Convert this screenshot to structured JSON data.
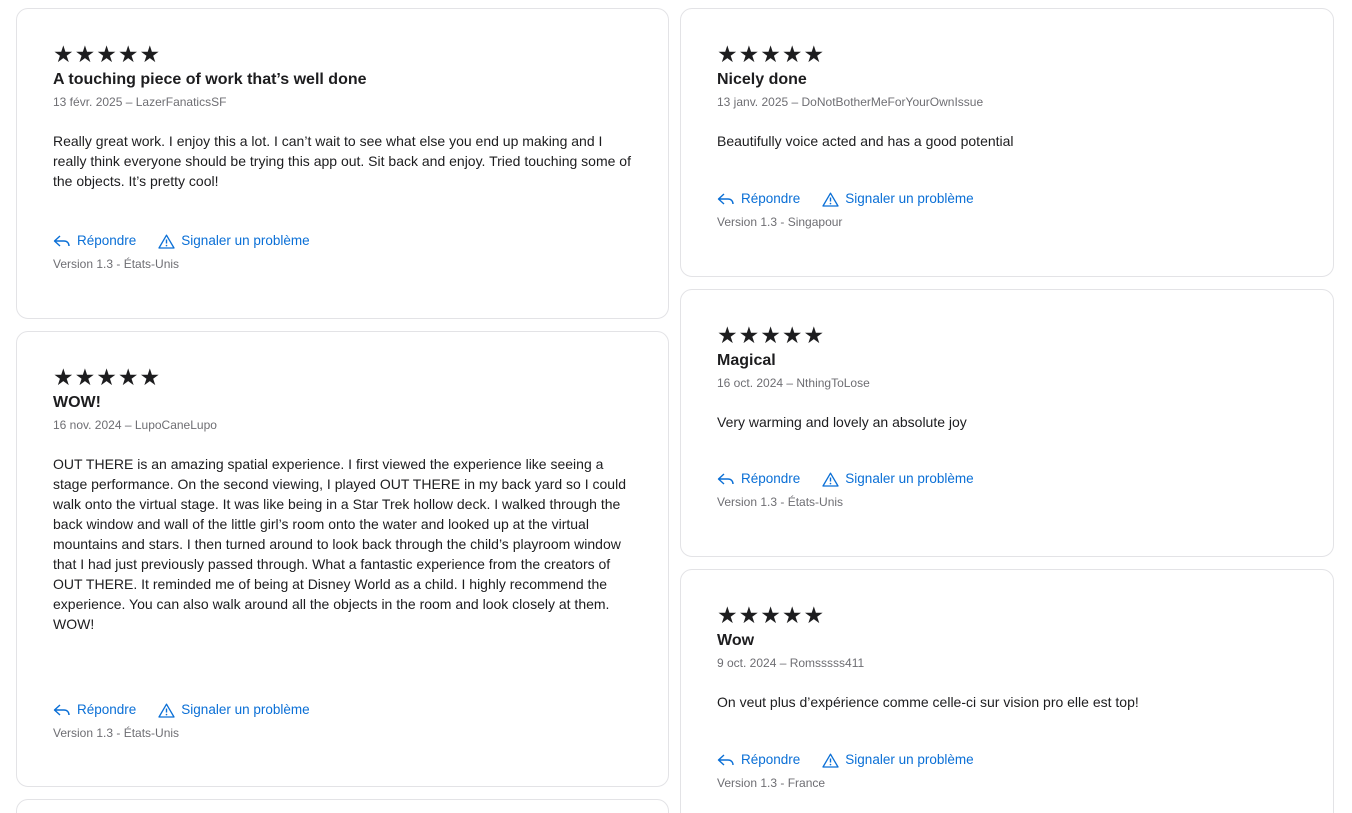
{
  "reviews": [
    {
      "stars": "★★★★★",
      "title": "A touching piece of work that’s well done",
      "meta": "13 févr. 2025 – LazerFanaticsSF",
      "body": "Really great work. I enjoy this a lot. I can’t wait to see what else you end up making and I really think everyone should be trying this app out. Sit back and enjoy. Tried touching some of the objects. It’s pretty cool!",
      "reply": "Répondre",
      "report": "Signaler un problème",
      "version": "Version 1.3 - États-Unis"
    },
    {
      "stars": "★★★★★",
      "title": "WOW!",
      "meta": "16 nov. 2024 – LupoCaneLupo",
      "body": "OUT THERE is an amazing spatial experience. I first viewed the experience like seeing a stage performance. On the second viewing, I played OUT THERE in my back yard so I could walk onto the virtual stage. It was like being in a Star Trek hollow deck. I walked through the back window and wall of the little girl’s room onto the water and looked up at the virtual mountains and stars. I then turned around to look back through the child’s playroom window that I had just previously passed through. What a fantastic experience from the creators of OUT THERE. It reminded me of being at Disney World as a child. I highly recommend the experience. You can also walk around all the objects in the room and look closely at them. WOW!",
      "reply": "Répondre",
      "report": "Signaler un problème",
      "version": "Version 1.3 - États-Unis"
    },
    {
      "stars": "★★★★★",
      "title": "Nicely done",
      "meta": "13 janv. 2025 – DoNotBotherMeForYourOwnIssue",
      "body": "Beautifully voice acted and has a good potential",
      "reply": "Répondre",
      "report": "Signaler un problème",
      "version": "Version 1.3 - Singapour"
    },
    {
      "stars": "★★★★★",
      "title": "Magical",
      "meta": "16 oct. 2024 – NthingToLose",
      "body": "Very warming and lovely an absolute joy",
      "reply": "Répondre",
      "report": "Signaler un problème",
      "version": "Version 1.3 - États-Unis"
    },
    {
      "stars": "★★★★★",
      "title": "Wow",
      "meta": "9 oct. 2024 – Romsssss411",
      "body": "On veut plus d’expérience comme celle-ci sur vision pro elle est top!",
      "reply": "Répondre",
      "report": "Signaler un problème",
      "version": "Version 1.3 - France"
    }
  ],
  "colors": {
    "link": "#0a6fd6",
    "border": "#e3e3e6",
    "muted": "#6e6e73"
  },
  "icons": {
    "reply": "reply-arrow-icon",
    "report": "warning-triangle-icon"
  }
}
